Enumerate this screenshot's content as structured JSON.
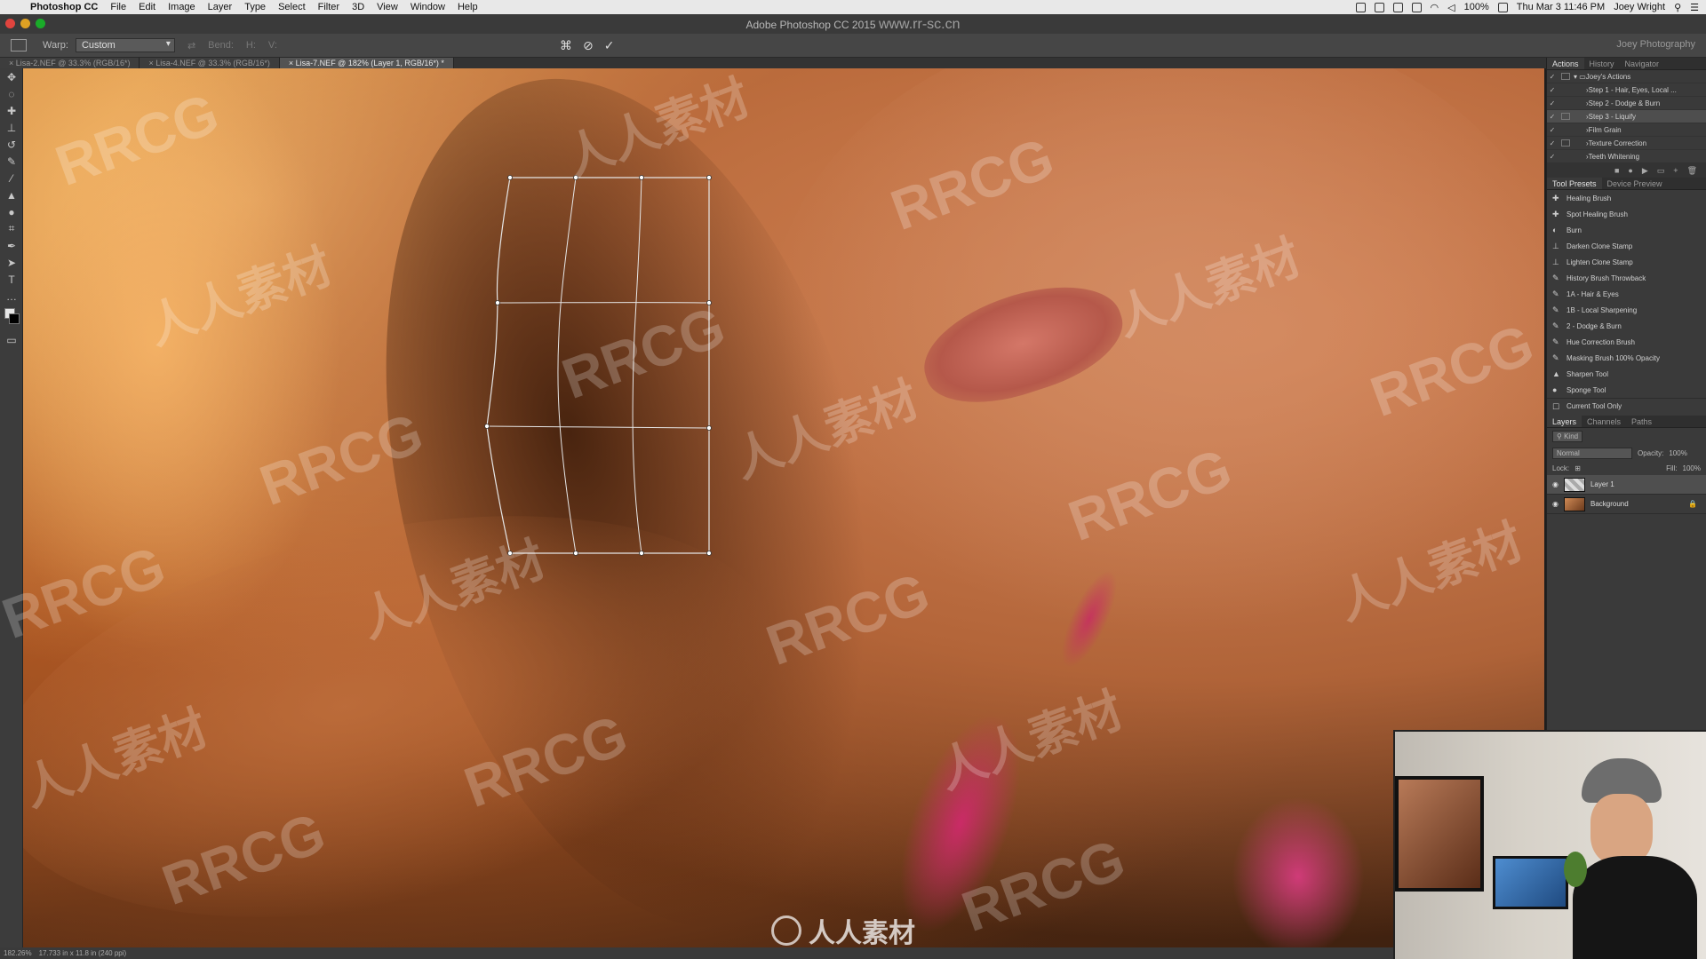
{
  "menubar": {
    "app": "Photoshop CC",
    "items": [
      "File",
      "Edit",
      "Image",
      "Layer",
      "Type",
      "Select",
      "Filter",
      "3D",
      "View",
      "Window",
      "Help"
    ],
    "battery": "100%",
    "datetime": "Thu Mar 3  11:46 PM",
    "user": "Joey Wright"
  },
  "window_title": "Adobe Photoshop CC 2015",
  "watermark_url": "www.rr-sc.cn",
  "options": {
    "warp_label": "Warp:",
    "warp_value": "Custom",
    "bend_label": "Bend:",
    "h_label": "H:",
    "v_label": "V:",
    "workspace": "Joey Photography"
  },
  "tabs": [
    "Lisa-2.NEF @ 33.3% (RGB/16*)",
    "Lisa-4.NEF @ 33.3% (RGB/16*)",
    "Lisa-7.NEF @ 182% (Layer 1, RGB/16*) *"
  ],
  "status": {
    "zoom": "182.26%",
    "doc": "17.733 in x 11.8 in (240 ppi)"
  },
  "actions_panel": {
    "tabs": [
      "Actions",
      "History",
      "Navigator"
    ],
    "set_name": "Joey's Actions",
    "items": [
      "Step 1 - Hair, Eyes, Local ...",
      "Step 2 - Dodge & Burn",
      "Step 3 - Liquify",
      "Film Grain",
      "Texture Correction",
      "Teeth Whitening"
    ]
  },
  "presets_panel": {
    "tabs": [
      "Tool Presets",
      "Device Preview"
    ],
    "items": [
      "Healing Brush",
      "Spot Healing Brush",
      "Burn",
      "Darken Clone Stamp",
      "Lighten Clone Stamp",
      "History Brush Throwback",
      "1A - Hair & Eyes",
      "1B - Local Sharpening",
      "2 - Dodge & Burn",
      "Hue Correction Brush",
      "Masking Brush 100% Opacity",
      "Sharpen Tool",
      "Sponge Tool"
    ],
    "current_only": "Current Tool Only"
  },
  "layers_panel": {
    "tabs": [
      "Layers",
      "Channels",
      "Paths"
    ],
    "kind": "Kind",
    "blend": "Normal",
    "opacity_label": "Opacity:",
    "opacity": "100%",
    "lock_label": "Lock:",
    "fill_label": "Fill:",
    "fill": "100%",
    "layers": [
      "Layer 1",
      "Background"
    ]
  },
  "watermarks": {
    "latin": "RRCG",
    "cjk": "人人素材"
  },
  "colors": {
    "accent": "#4a8fd8",
    "skin": "#c9875a",
    "hair": "#7a3d16"
  }
}
